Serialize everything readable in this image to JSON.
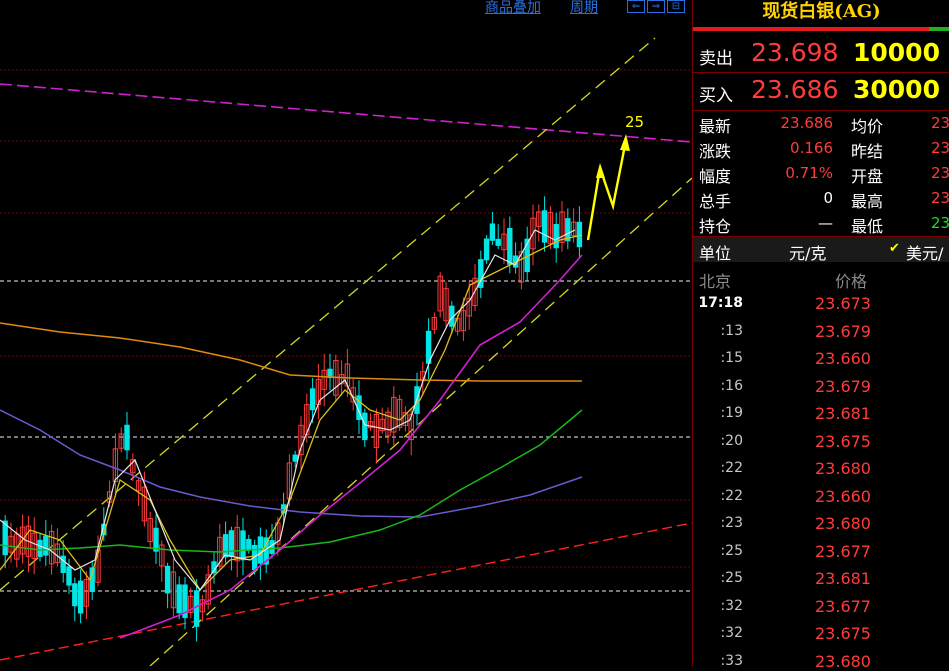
{
  "toolbar": {
    "overlay_label": "商品叠加",
    "period_label": "周期",
    "nav_buttons": [
      "⇐",
      "⇒",
      "⊟"
    ]
  },
  "chart_data": {
    "type": "candlestick",
    "annotation": "25",
    "colors": {
      "up": "#ff3b3b",
      "down": "#00e5e5",
      "ma_white": "#e8e8e8",
      "ma_yellow": "#d8c21a",
      "ma_magenta": "#d020d0",
      "ma_green": "#18b818",
      "ma_purple": "#6a5acd",
      "ma_orange": "#e08a10",
      "channel": "#d8d820",
      "trend_red": "#ff2020",
      "resistance": "#d020d0",
      "arrow": "#ffff00"
    }
  },
  "panel": {
    "title": "现货白银(AG)",
    "sell": {
      "label": "卖出",
      "price": "23.698",
      "volume": "10000"
    },
    "buy": {
      "label": "买入",
      "price": "23.686",
      "volume": "30000"
    },
    "quote": [
      {
        "label": "最新",
        "value": "23.686",
        "label2": "均价",
        "value2": "23"
      },
      {
        "label": "涨跌",
        "value": "0.166",
        "label2": "昨结",
        "value2": "23"
      },
      {
        "label": "幅度",
        "value": "0.71%",
        "label2": "开盘",
        "value2": "23"
      },
      {
        "label": "总手",
        "value": "0",
        "label2": "最高",
        "value2": "23"
      },
      {
        "label": "持仓",
        "value": "—",
        "label2": "最低",
        "value2": "23"
      }
    ],
    "unit": {
      "label": "单位",
      "value": "元/克",
      "alt": "美元/"
    },
    "ticks_header": {
      "location": "北京",
      "price": "价格"
    },
    "ticks": [
      {
        "time": "17:18",
        "price": "23.673"
      },
      {
        "time": ":13",
        "price": "23.679"
      },
      {
        "time": ":15",
        "price": "23.660"
      },
      {
        "time": ":16",
        "price": "23.679"
      },
      {
        "time": ":19",
        "price": "23.681"
      },
      {
        "time": ":20",
        "price": "23.675"
      },
      {
        "time": ":22",
        "price": "23.680"
      },
      {
        "time": ":22",
        "price": "23.660"
      },
      {
        "time": ":23",
        "price": "23.680"
      },
      {
        "time": ":25",
        "price": "23.677"
      },
      {
        "time": ":25",
        "price": "23.681"
      },
      {
        "time": ":32",
        "price": "23.677"
      },
      {
        "time": ":32",
        "price": "23.675"
      },
      {
        "time": ":33",
        "price": "23.680"
      }
    ]
  }
}
